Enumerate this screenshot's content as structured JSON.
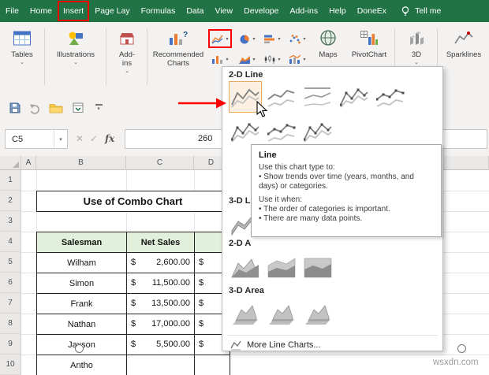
{
  "topbar": {
    "tabs": [
      "File",
      "Home",
      "Insert",
      "Page Lay",
      "Formulas",
      "Data",
      "View",
      "Develope",
      "Add-ins",
      "Help",
      "DoneEx"
    ],
    "tellme": "Tell me"
  },
  "ribbon": {
    "tables": "Tables",
    "illustrations": "Illustrations",
    "addins_line1": "Add-",
    "addins_line2": "ins",
    "recommended_line1": "Recommended",
    "recommended_line2": "Charts",
    "maps": "Maps",
    "pivotchart": "PivotChart",
    "map3d": "3D",
    "sparklines": "Sparklines"
  },
  "formula": {
    "name_box": "C5",
    "cancel": "✕",
    "check": "✓",
    "fx": "fx",
    "value": "260"
  },
  "dropdown": {
    "section_2d_line": "2-D Line",
    "section_3d_line": "3-D L",
    "section_2d_area": "2-D A",
    "section_3d_area": "3-D Area",
    "more_label": "More Line Charts..."
  },
  "tooltip": {
    "title": "Line",
    "intro": "Use this chart type to:",
    "bullet_trends": "• Show trends over time (years, months, and days) or categories.",
    "when": "Use it when:",
    "bullet_order": "• The order of categories is important.",
    "bullet_points": "• There are many data points."
  },
  "sheet": {
    "col_headers": [
      "A",
      "B",
      "C",
      "D"
    ],
    "row_headers": [
      "1",
      "2",
      "3",
      "4",
      "5",
      "6",
      "7",
      "8",
      "9",
      "10"
    ],
    "title": "Use of Combo Chart",
    "header_salesman": "Salesman",
    "header_net_sales": "Net Sales",
    "rows": [
      {
        "name": "Wilham",
        "cur": "$",
        "amount": "2,600.00",
        "next": "$"
      },
      {
        "name": "Simon",
        "cur": "$",
        "amount": "11,500.00",
        "next": "$"
      },
      {
        "name": "Frank",
        "cur": "$",
        "amount": "13,500.00",
        "next": "$"
      },
      {
        "name": "Nathan",
        "cur": "$",
        "amount": "17,000.00",
        "next": "$"
      },
      {
        "name": "Jaxson",
        "cur": "$",
        "amount": "5,500.00",
        "next": "$"
      },
      {
        "name": "Antho",
        "cur": "",
        "amount": "",
        "next": ""
      }
    ]
  },
  "icons": {
    "caret_down": "⌄",
    "caret_small": "▾"
  },
  "watermark": "wsxdn.com",
  "colors": {
    "excel_green": "#217346",
    "annotation_red": "#FF0000",
    "table_header_green": "#E2EFDA"
  }
}
